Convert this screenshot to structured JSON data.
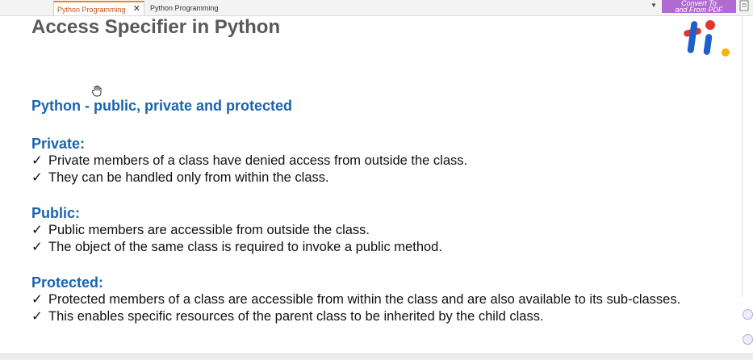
{
  "tabs": [
    {
      "label": "Python Programming",
      "active": true
    },
    {
      "label": "Python Programming",
      "active": false
    }
  ],
  "tab_close_symbol": "✕",
  "banner": {
    "line1": "Convert To",
    "line2": "and From PDF"
  },
  "page_title": "Access Specifier in Python",
  "subtitle": "Python - public, private and protected",
  "sections": [
    {
      "heading": "Private:",
      "bullets": [
        "Private members of a class have denied access from outside the class.",
        "They can be handled only from within the class."
      ]
    },
    {
      "heading": "Public:",
      "bullets": [
        "Public members are accessible from outside the class.",
        "The object of the same class is required to invoke a public method."
      ]
    },
    {
      "heading": "Protected:",
      "bullets": [
        "Protected members of a class are accessible from within the class and are also available to its sub-classes.",
        "This enables specific resources of the parent class to be inherited by the child class."
      ]
    }
  ],
  "check_symbol": "✓",
  "colors": {
    "heading_blue": "#1b63b0",
    "title_gray": "#595959",
    "tab_accent": "#e08a3a",
    "banner_purple": "#b06ad0",
    "logo_red": "#e3342f",
    "logo_blue": "#1f5fc9",
    "logo_yellow": "#f4b400"
  },
  "icons": {
    "logo": "brand-logo-icon",
    "cursor": "hand-cursor-icon",
    "dropdown": "chevron-down-icon",
    "close": "close-icon"
  }
}
